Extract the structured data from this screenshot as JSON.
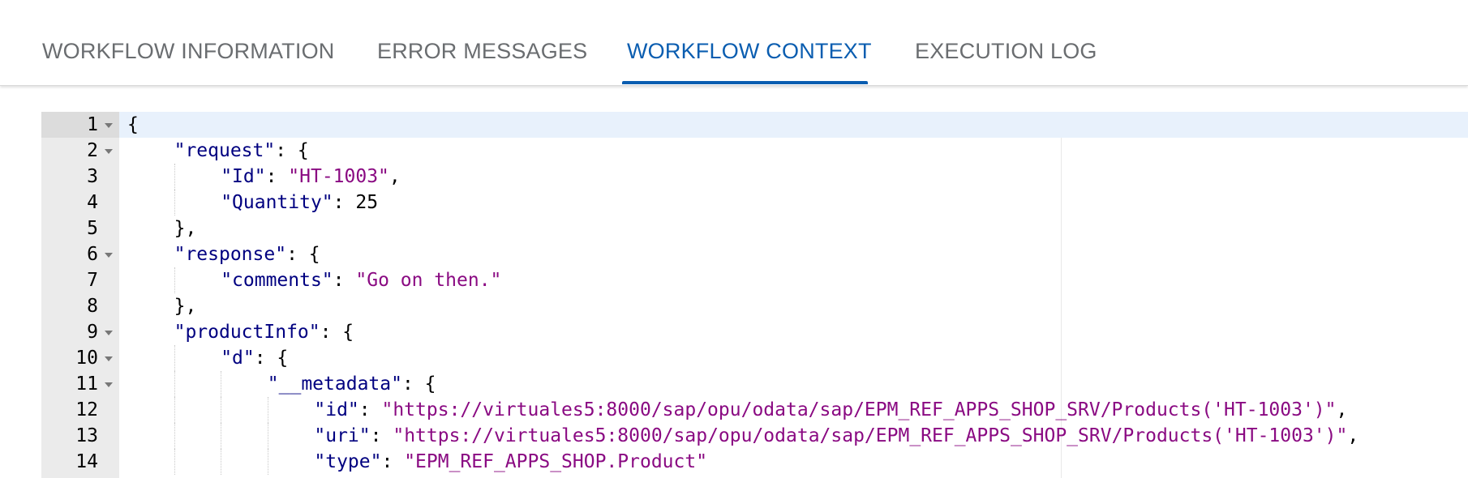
{
  "tabs": [
    {
      "label": "WORKFLOW INFORMATION",
      "active": false
    },
    {
      "label": "ERROR MESSAGES",
      "active": false
    },
    {
      "label": "WORKFLOW CONTEXT",
      "active": true
    },
    {
      "label": "EXECUTION LOG",
      "active": false
    }
  ],
  "colors": {
    "accent": "#0a5db0",
    "tab_inactive": "#6a6d70",
    "json_key": "#000080",
    "json_string": "#8a0a82",
    "active_line": "#e8f1fc"
  },
  "editor": {
    "active_line": 1,
    "lines": [
      {
        "num": "1",
        "fold": true,
        "indent": 0,
        "parts": [
          {
            "t": "pun",
            "v": "{"
          }
        ]
      },
      {
        "num": "2",
        "fold": true,
        "indent": 1,
        "parts": [
          {
            "t": "key",
            "v": "\"request\""
          },
          {
            "t": "pun",
            "v": ": {"
          }
        ]
      },
      {
        "num": "3",
        "fold": false,
        "indent": 2,
        "parts": [
          {
            "t": "key",
            "v": "\"Id\""
          },
          {
            "t": "pun",
            "v": ": "
          },
          {
            "t": "str",
            "v": "\"HT-1003\""
          },
          {
            "t": "pun",
            "v": ","
          }
        ]
      },
      {
        "num": "4",
        "fold": false,
        "indent": 2,
        "parts": [
          {
            "t": "key",
            "v": "\"Quantity\""
          },
          {
            "t": "pun",
            "v": ": "
          },
          {
            "t": "num",
            "v": "25"
          }
        ]
      },
      {
        "num": "5",
        "fold": false,
        "indent": 1,
        "parts": [
          {
            "t": "pun",
            "v": "},"
          }
        ]
      },
      {
        "num": "6",
        "fold": true,
        "indent": 1,
        "parts": [
          {
            "t": "key",
            "v": "\"response\""
          },
          {
            "t": "pun",
            "v": ": {"
          }
        ]
      },
      {
        "num": "7",
        "fold": false,
        "indent": 2,
        "parts": [
          {
            "t": "key",
            "v": "\"comments\""
          },
          {
            "t": "pun",
            "v": ": "
          },
          {
            "t": "str",
            "v": "\"Go on then.\""
          }
        ]
      },
      {
        "num": "8",
        "fold": false,
        "indent": 1,
        "parts": [
          {
            "t": "pun",
            "v": "},"
          }
        ]
      },
      {
        "num": "9",
        "fold": true,
        "indent": 1,
        "parts": [
          {
            "t": "key",
            "v": "\"productInfo\""
          },
          {
            "t": "pun",
            "v": ": {"
          }
        ]
      },
      {
        "num": "10",
        "fold": true,
        "indent": 2,
        "parts": [
          {
            "t": "key",
            "v": "\"d\""
          },
          {
            "t": "pun",
            "v": ": {"
          }
        ]
      },
      {
        "num": "11",
        "fold": true,
        "indent": 3,
        "parts": [
          {
            "t": "key",
            "v": "\"__metadata\""
          },
          {
            "t": "pun",
            "v": ": {"
          }
        ]
      },
      {
        "num": "12",
        "fold": false,
        "indent": 4,
        "parts": [
          {
            "t": "key",
            "v": "\"id\""
          },
          {
            "t": "pun",
            "v": ": "
          },
          {
            "t": "str",
            "v": "\"https://virtuales5:8000/sap/opu/odata/sap/EPM_REF_APPS_SHOP_SRV/Products('HT-1003')\""
          },
          {
            "t": "pun",
            "v": ","
          }
        ]
      },
      {
        "num": "13",
        "fold": false,
        "indent": 4,
        "parts": [
          {
            "t": "key",
            "v": "\"uri\""
          },
          {
            "t": "pun",
            "v": ": "
          },
          {
            "t": "str",
            "v": "\"https://virtuales5:8000/sap/opu/odata/sap/EPM_REF_APPS_SHOP_SRV/Products('HT-1003')\""
          },
          {
            "t": "pun",
            "v": ","
          }
        ]
      },
      {
        "num": "14",
        "fold": false,
        "indent": 4,
        "parts": [
          {
            "t": "key",
            "v": "\"type\""
          },
          {
            "t": "pun",
            "v": ": "
          },
          {
            "t": "str",
            "v": "\"EPM_REF_APPS_SHOP.Product\""
          }
        ]
      }
    ]
  }
}
